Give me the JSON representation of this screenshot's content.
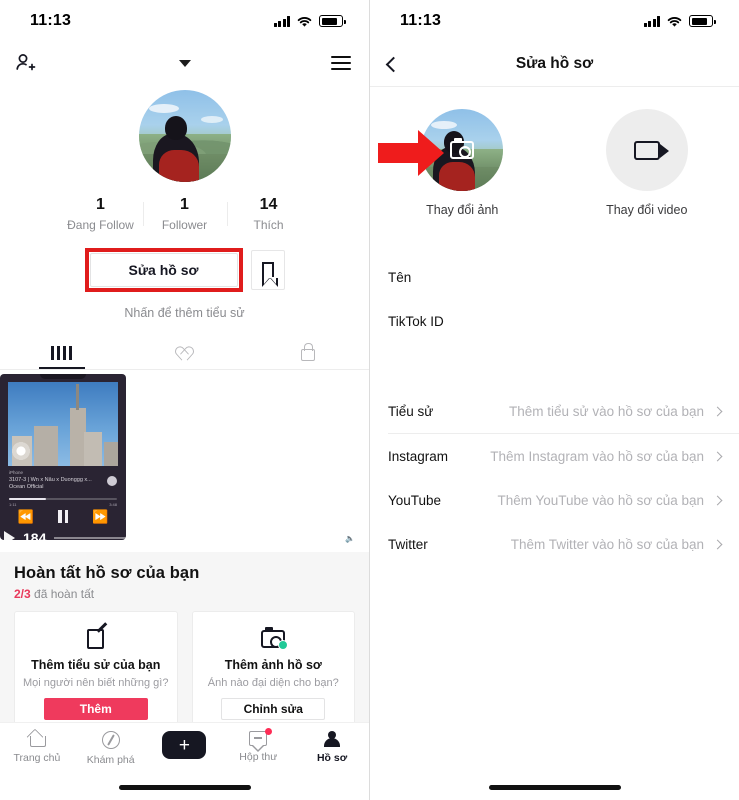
{
  "status_bar": {
    "time": "11:13",
    "signal_icon": "cellular-signal-icon",
    "wifi_icon": "wifi-icon",
    "battery_icon": "battery-icon"
  },
  "left_screen": {
    "topbar": {
      "add_friend_icon": "add-person-icon",
      "dropdown_icon": "chevron-down-icon",
      "menu_icon": "hamburger-menu-icon"
    },
    "avatar": {
      "name": "profile-avatar"
    },
    "stats": [
      {
        "value": "1",
        "label": "Đang Follow"
      },
      {
        "value": "1",
        "label": "Follower"
      },
      {
        "value": "14",
        "label": "Thích"
      }
    ],
    "edit_profile_button": "Sửa hồ sơ",
    "bookmark_icon": "bookmark-icon",
    "bio_hint": "Nhấn để thêm tiểu sử",
    "tabs": [
      {
        "icon": "grid-icon",
        "active": true
      },
      {
        "icon": "liked-heart-icon",
        "active": false
      },
      {
        "icon": "lock-icon",
        "active": false
      }
    ],
    "video_card": {
      "track_source": "iPhone",
      "track_title": "3107-3 | Wn x Nâu x Duonggg x...",
      "track_artist": "Ocean Official",
      "time_elapsed": "1:11",
      "time_total": "3:48",
      "prev_icon": "rewind-icon",
      "pause_icon": "pause-icon",
      "next_icon": "fast-forward-icon",
      "play_icon": "play-icon",
      "play_count": "184",
      "volume_icon": "speaker-icon"
    },
    "completion": {
      "title": "Hoàn tất hồ sơ của bạn",
      "progress": "2/3",
      "progress_suffix": "đã hoàn tất",
      "cards": [
        {
          "icon": "note-edit-icon",
          "title": "Thêm tiểu sử của bạn",
          "desc": "Mọi người nên biết những gì?",
          "cta": "Thêm",
          "cta_style": "primary"
        },
        {
          "icon": "camera-check-icon",
          "title": "Thêm ảnh hồ sơ",
          "desc": "Ảnh nào đại diện cho bạn?",
          "cta": "Chỉnh sửa",
          "cta_style": "ghost"
        }
      ]
    },
    "bottom_nav": [
      {
        "icon": "home-icon",
        "label": "Trang chủ",
        "active": false
      },
      {
        "icon": "compass-icon",
        "label": "Khám phá",
        "active": false
      },
      {
        "icon": "plus-icon",
        "label": "",
        "active": false
      },
      {
        "icon": "inbox-message-icon",
        "label": "Hộp thư",
        "active": false,
        "badge": true
      },
      {
        "icon": "person-icon",
        "label": "Hồ sơ",
        "active": true
      }
    ]
  },
  "right_screen": {
    "header": {
      "back_icon": "back-chevron-icon",
      "title": "Sửa hồ sơ"
    },
    "media": [
      {
        "icon": "camera-icon",
        "label": "Thay đổi ảnh",
        "kind": "photo"
      },
      {
        "icon": "video-camera-icon",
        "label": "Thay đổi video",
        "kind": "video"
      }
    ],
    "annotation": {
      "icon": "red-arrow-icon"
    },
    "fields": [
      {
        "label": "Tên",
        "value": "",
        "chevron": false
      },
      {
        "label": "TikTok ID",
        "value": "",
        "chevron": false
      },
      {
        "label": "Tiểu sử",
        "value": "Thêm tiểu sử vào hồ sơ của bạn",
        "chevron": true
      },
      {
        "label": "Instagram",
        "value": "Thêm Instagram vào hồ sơ của bạn",
        "chevron": true
      },
      {
        "label": "YouTube",
        "value": "Thêm YouTube vào hồ sơ của bạn",
        "chevron": true
      },
      {
        "label": "Twitter",
        "value": "Thêm Twitter vào hồ sơ của bạn",
        "chevron": true
      }
    ]
  },
  "colors": {
    "accent_red": "#ef1c1c",
    "highlight_red": "#e01c1c",
    "cta_pink": "#ef3a5d",
    "text_dark": "#121212",
    "text_muted": "#8a8b8f"
  }
}
